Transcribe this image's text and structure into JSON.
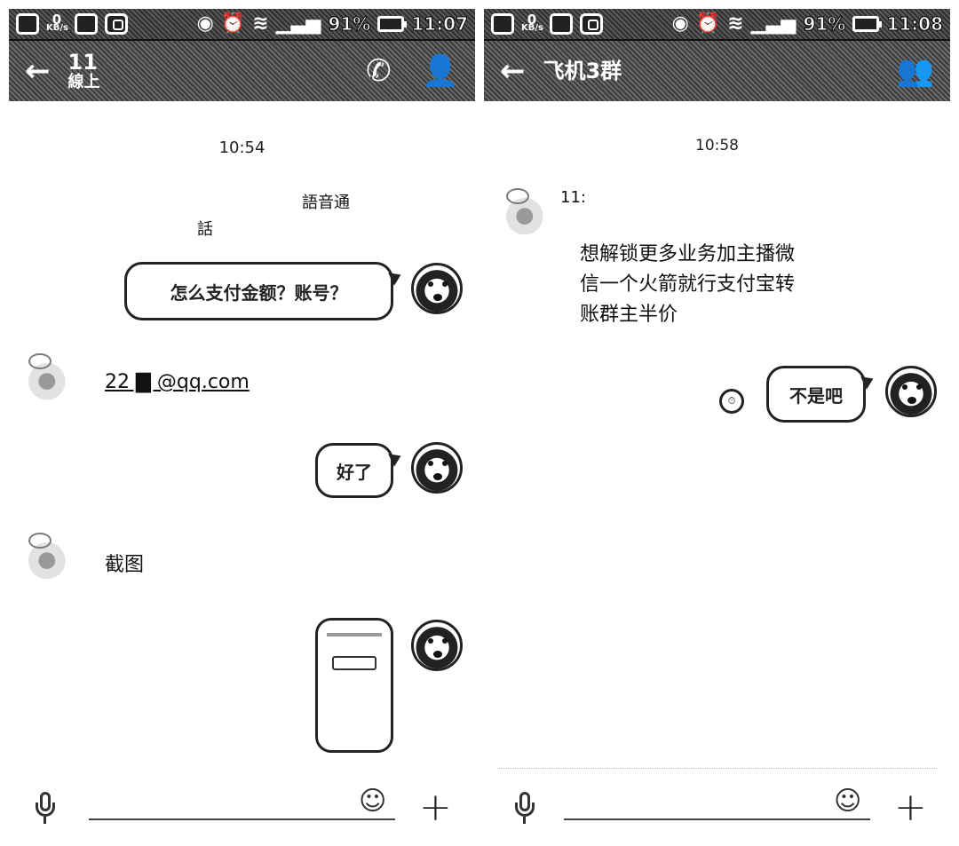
{
  "left": {
    "status_bar": {
      "net_speed_value": "0",
      "net_speed_unit": "KB/s",
      "battery": "91%",
      "time": "11:07"
    },
    "header": {
      "title": "11",
      "subtitle": "線上",
      "icons": [
        "back-arrow-icon",
        "phone-icon",
        "person-icon"
      ]
    },
    "messages": {
      "timestamp": "10:54",
      "system_line1": "語音通",
      "system_line2": "話",
      "sent1": "怎么支付金额？账号？",
      "received_email": "22  ▇  @qq.com",
      "sent2": "好了",
      "received2": "截图"
    }
  },
  "right": {
    "status_bar": {
      "net_speed_value": "0",
      "net_speed_unit": "KB/s",
      "battery": "91%",
      "time": "11:08"
    },
    "header": {
      "title": "飞机3群",
      "icons": [
        "back-arrow-icon",
        "group-icon"
      ]
    },
    "messages": {
      "timestamp": "10:58",
      "sender_name": "11:",
      "received_line1": "想解锁更多业务加主播微",
      "received_line2": "信一个火箭就行支付宝转",
      "received_line3": "账群主半价",
      "sent1": "不是吧"
    }
  }
}
